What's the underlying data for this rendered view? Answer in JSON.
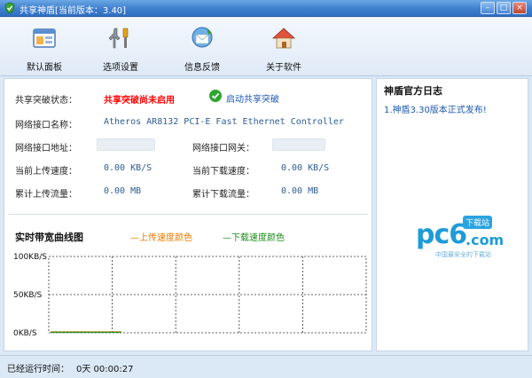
{
  "window": {
    "title": "共享神盾[当前版本：3.40]",
    "buttons": {
      "minimize": "–",
      "maximize": "□",
      "close": "×"
    }
  },
  "toolbar": {
    "items": [
      {
        "label": "默认面板",
        "icon": "panel-icon"
      },
      {
        "label": "选项设置",
        "icon": "tools-icon"
      },
      {
        "label": "信息反馈",
        "icon": "feedback-icon"
      },
      {
        "label": "关于软件",
        "icon": "home-icon"
      }
    ]
  },
  "status": {
    "share_label": "共享突破状态：",
    "share_value": "共享突破尚未启用",
    "start_button": "启动共享突破",
    "iface_name_label": "网络接口名称：",
    "iface_name_value": "Atheros AR8132 PCI-E Fast Ethernet Controller",
    "iface_addr_label": "网络接口地址：",
    "iface_gw_label": "网络接口网关：",
    "up_speed_label": "当前上传速度：",
    "up_speed_value": "0.00 KB/S",
    "down_speed_label": "当前下载速度：",
    "down_speed_value": "0.00 KB/S",
    "up_total_label": "累计上传流量：",
    "up_total_value": "0.00 MB",
    "down_total_label": "累计下载流量：",
    "down_total_value": "0.00 MB"
  },
  "chart": {
    "title": "实时带宽曲线图",
    "legend_up": "—上传速度颜色",
    "legend_down": "—下载速度颜色",
    "y_labels": [
      "100KB/S",
      "50KB/S",
      "0KB/S"
    ],
    "colors": {
      "up": "#e67e00",
      "down": "#1a8d1a"
    }
  },
  "chart_data": {
    "type": "line",
    "title": "实时带宽曲线图",
    "ytick_labels": [
      "100KB/S",
      "50KB/S",
      "0KB/S"
    ],
    "ylim": [
      0,
      100
    ],
    "series": [
      {
        "name": "上传速度颜色",
        "values": [
          0,
          0,
          0,
          0,
          0,
          0,
          0,
          0,
          0,
          0
        ]
      },
      {
        "name": "下载速度颜色",
        "values": [
          0,
          0,
          0,
          0,
          0,
          0,
          0,
          0,
          0,
          0
        ]
      }
    ],
    "grid": true
  },
  "side": {
    "title": "神盾官方日志",
    "news": "1.神盾3.30版本正式发布!",
    "logo_text": "pc6",
    "logo_com": ".com",
    "logo_badge": "下载站",
    "logo_tagline": "中国最安全的下载站"
  },
  "statusbar": {
    "label": "已经运行时间：",
    "time": "0天 00:00:27"
  }
}
